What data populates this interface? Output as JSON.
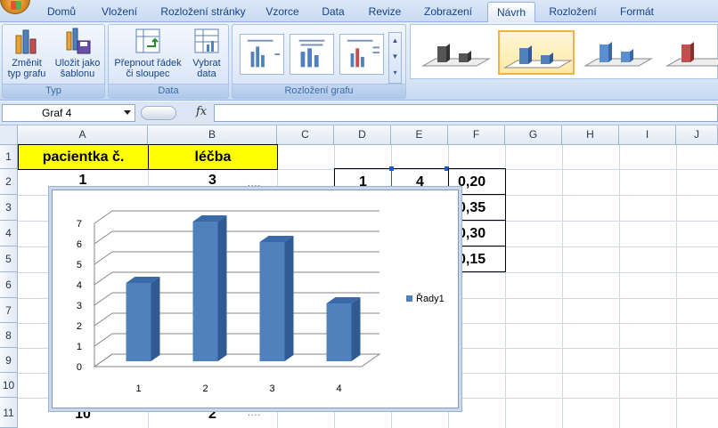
{
  "tabs": [
    {
      "label": "Domů",
      "active": false
    },
    {
      "label": "Vložení",
      "active": false
    },
    {
      "label": "Rozložení stránky",
      "active": false
    },
    {
      "label": "Vzorce",
      "active": false
    },
    {
      "label": "Data",
      "active": false
    },
    {
      "label": "Revize",
      "active": false
    },
    {
      "label": "Zobrazení",
      "active": false
    },
    {
      "label": "Návrh",
      "active": true
    },
    {
      "label": "Rozložení",
      "active": false
    },
    {
      "label": "Formát",
      "active": false
    }
  ],
  "ribbon": {
    "type_group": {
      "label": "Typ",
      "change_type_line1": "Změnit",
      "change_type_line2": "typ grafu",
      "save_template_line1": "Uložit jako",
      "save_template_line2": "šablonu"
    },
    "data_group": {
      "label": "Data",
      "switch_line1": "Přepnout řádek",
      "switch_line2": "či sloupec",
      "select_line1": "Vybrat",
      "select_line2": "data"
    },
    "layout_group": {
      "label": "Rozložení grafu"
    }
  },
  "formula_bar": {
    "name_box": "Graf 4",
    "fx_label": "fx",
    "formula": ""
  },
  "columns": [
    "A",
    "B",
    "C",
    "D",
    "E",
    "F",
    "G",
    "H",
    "I",
    "J"
  ],
  "rows": [
    "1",
    "2",
    "3",
    "4",
    "5",
    "6",
    "7",
    "8",
    "9",
    "10",
    "11"
  ],
  "cells": {
    "A1": "pacientka č.",
    "B1": "léčba",
    "A2": "1",
    "B2": "3",
    "A11": "10",
    "B11": "2",
    "D2": "1",
    "E2": "4",
    "F2": "0,20",
    "F3": "0,35",
    "F4": "0,30",
    "F5": "0,15"
  },
  "chart_data": {
    "type": "bar",
    "categories": [
      "1",
      "2",
      "3",
      "4"
    ],
    "series": [
      {
        "name": "Řady1",
        "values": [
          4,
          7,
          6,
          3
        ],
        "color": "#4f81bd"
      }
    ],
    "ylim": [
      0,
      7
    ],
    "yticks": [
      "0",
      "1",
      "2",
      "3",
      "4",
      "5",
      "6",
      "7"
    ],
    "grid": true,
    "legend": "right",
    "three_d": true
  }
}
